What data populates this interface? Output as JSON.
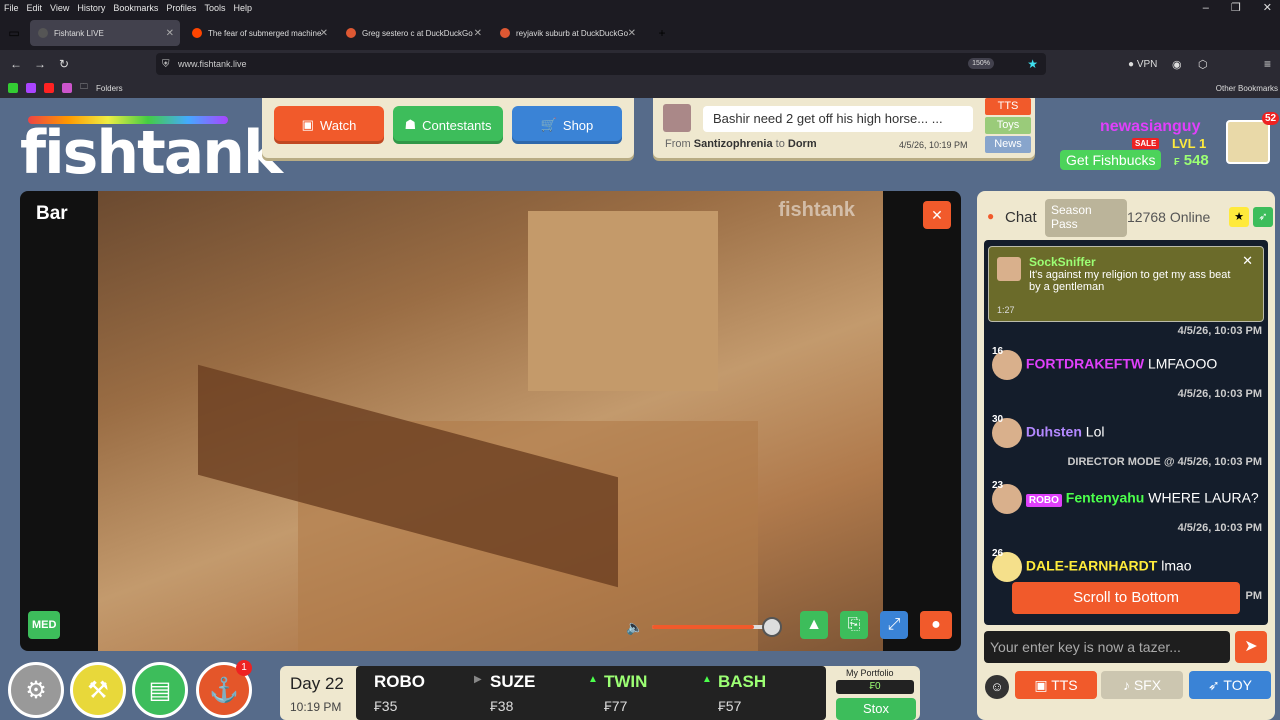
{
  "browser": {
    "menu": [
      "File",
      "Edit",
      "View",
      "History",
      "Bookmarks",
      "Profiles",
      "Tools",
      "Help"
    ],
    "tabs": [
      {
        "label": "Fishtank LIVE",
        "active": true
      },
      {
        "label": "The fear of submerged machine",
        "active": false
      },
      {
        "label": "Greg sestero c at DuckDuckGo",
        "active": false
      },
      {
        "label": "reyjavik suburb at DuckDuckGo",
        "active": false
      }
    ],
    "url": "www.fishtank.live",
    "zoom": "150%",
    "vpn": "VPN",
    "bookmarks_folder": "Folders",
    "other_bookmarks": "Other Bookmarks"
  },
  "site": {
    "logo": "fishtank",
    "nav": {
      "watch": "Watch",
      "contestants": "Contestants",
      "shop": "Shop"
    },
    "ticker": {
      "message": "Bashir need 2 get off his high horse... ...",
      "from_label": "From",
      "from": "Santizophrenia",
      "to_label": "to",
      "to": "Dorm",
      "time": "4/5/26, 10:19 PM",
      "buttons": [
        "TTS",
        "Toys",
        "News"
      ]
    },
    "user": {
      "name": "newasianguy",
      "sale": "SALE",
      "level": "LVL 1",
      "get_fishbucks": "Get Fishbucks",
      "balance": "548",
      "currency": "₣",
      "notifications": "52"
    }
  },
  "video": {
    "room": "Bar",
    "watermark": "fishtank",
    "quality": "MED",
    "close": "✕",
    "volume": 0.85
  },
  "chat": {
    "title": "Chat",
    "season_pass": "Season Pass",
    "online": "12768 Online",
    "pinned": {
      "user": "SockSniffer",
      "text": "It's against my religion to get my ass beat by a gentleman",
      "time": "1:27"
    },
    "messages": [
      {
        "top_ts": "4/5/26, 10:03 PM",
        "level": "16",
        "user": "FORTDRAKEFTW",
        "user_color": "#e040fb",
        "text": "LMFAOOO",
        "ts": "4/5/26, 10:03 PM"
      },
      {
        "level": "30",
        "user": "Duhsten",
        "user_color": "#b388ff",
        "text": "Lol",
        "ts": "DIRECTOR MODE @ 4/5/26, 10:03 PM"
      },
      {
        "level": "23",
        "badge": "ROBO",
        "user": "Fentenyahu",
        "user_color": "#4cff4c",
        "text": "WHERE LAURA?",
        "ts": "4/5/26, 10:03 PM"
      },
      {
        "level": "26",
        "user": "DALE-EARNHARDT",
        "user_color": "#ffeb3b",
        "text": "lmao",
        "ts": "PM"
      }
    ],
    "scroll_to_bottom": "Scroll to Bottom",
    "input_placeholder": "Your enter key is now a tazer...",
    "tts": "TTS",
    "sfx": "SFX",
    "toy": "TOY"
  },
  "bottom": {
    "notify_count": "1",
    "day": "Day 22",
    "time": "10:19 PM",
    "stocks": [
      {
        "name": "ROBO",
        "value": "35",
        "trend": "flat"
      },
      {
        "name": "SUZE",
        "value": "38",
        "trend": "flat"
      },
      {
        "name": "TWIN",
        "value": "77",
        "trend": "up"
      },
      {
        "name": "BASH",
        "value": "57",
        "trend": "up"
      }
    ],
    "portfolio_label": "My Portfolio",
    "portfolio_value": "₣0",
    "stox": "Stox"
  }
}
